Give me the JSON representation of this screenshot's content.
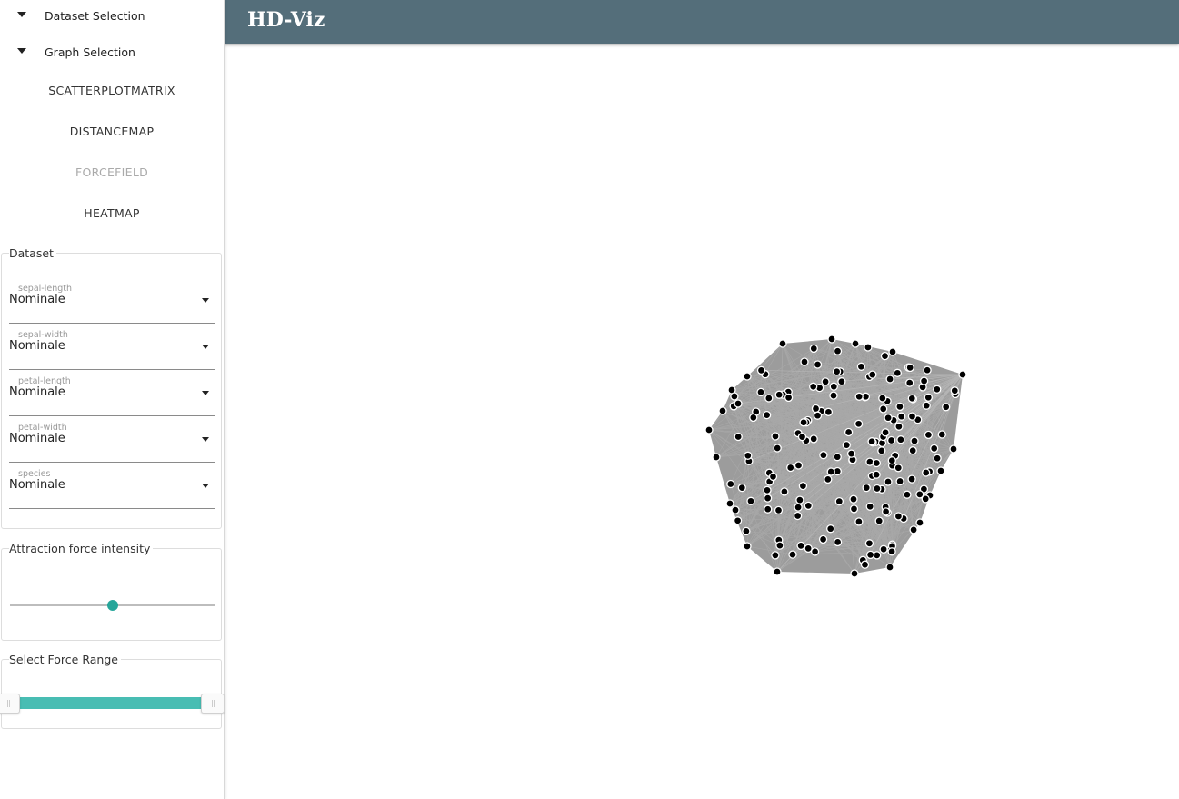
{
  "app": {
    "title": "HD-Viz"
  },
  "sidebar": {
    "dataset_selection": {
      "label": "Dataset Selection"
    },
    "graph_selection": {
      "label": "Graph Selection"
    },
    "graphs": [
      {
        "label": "SCATTERPLOTMATRIX",
        "active": true
      },
      {
        "label": "DISTANCEMAP",
        "active": true
      },
      {
        "label": "FORCEFIELD",
        "active": false
      },
      {
        "label": "HEATMAP",
        "active": true
      }
    ],
    "dataset": {
      "legend": "Dataset",
      "fields": [
        {
          "name": "sepal-length",
          "value": "Nominale"
        },
        {
          "name": "sepal-width",
          "value": "Nominale"
        },
        {
          "name": "petal-length",
          "value": "Nominale"
        },
        {
          "name": "petal-width",
          "value": "Nominale"
        },
        {
          "name": "species",
          "value": "Nominale"
        }
      ]
    },
    "attraction": {
      "legend": "Attraction force intensity",
      "value_fraction": 0.5
    },
    "force_range": {
      "legend": "Select Force Range",
      "range": [
        0,
        1
      ]
    }
  },
  "colors": {
    "header": "#546e7a",
    "accent": "#26a69a",
    "range_fill": "#48bdb3",
    "edge": "#a8a8a8",
    "node": "#000000"
  },
  "icons": {
    "section_caret": "caret-down-icon",
    "select_caret": "dropdown-arrow-icon"
  }
}
